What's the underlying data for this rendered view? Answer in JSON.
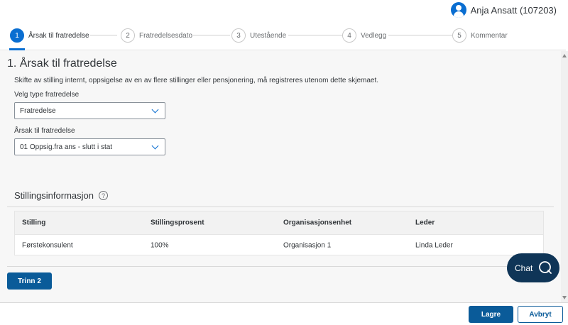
{
  "user": {
    "name": "Anja Ansatt (107203)",
    "icon": "user-avatar-icon"
  },
  "steps": [
    {
      "number": "1",
      "label": "Årsak til fratredelse",
      "active": true
    },
    {
      "number": "2",
      "label": "Fratredelsesdato",
      "active": false
    },
    {
      "number": "3",
      "label": "Utestående",
      "active": false
    },
    {
      "number": "4",
      "label": "Vedlegg",
      "active": false
    },
    {
      "number": "5",
      "label": "Kommentar",
      "active": false
    }
  ],
  "page": {
    "title": "1. Årsak til fratredelse",
    "info": "Skifte av stilling internt, oppsigelse av en av flere stillinger eller pensjonering, må registreres utenom dette skjemaet."
  },
  "fields": {
    "type_label": "Velg type fratredelse",
    "type_value": "Fratredelse",
    "reason_label": "Årsak til fratredelse",
    "reason_value": "01 Oppsig.fra ans - slutt i stat"
  },
  "position_section": {
    "title": "Stillingsinformasjon",
    "help": "?",
    "columns": [
      "Stilling",
      "Stillingsprosent",
      "Organisasjonsenhet",
      "Leder"
    ],
    "rows": [
      [
        "Førstekonsulent",
        "100%",
        "Organisasjon 1",
        "Linda Leder"
      ]
    ]
  },
  "buttons": {
    "next_step": "Trinn 2",
    "save": "Lagre",
    "cancel": "Avbryt",
    "chat": "Chat"
  },
  "colors": {
    "accent": "#0a6ed1",
    "primary_button": "#0a5b99",
    "chat_bg": "#0f3557"
  }
}
